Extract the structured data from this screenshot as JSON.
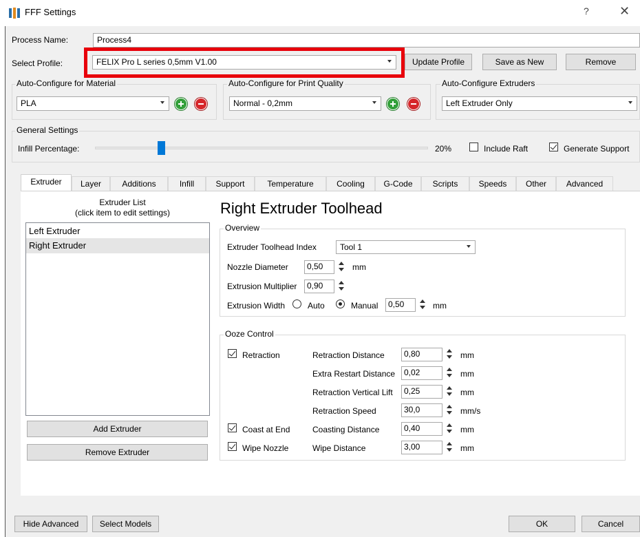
{
  "window": {
    "title": "FFF Settings",
    "help": "?",
    "close": "✕"
  },
  "process": {
    "label": "Process Name:",
    "value": "Process4"
  },
  "profile": {
    "label": "Select Profile:",
    "value": "FELIX Pro L series 0,5mm V1.00",
    "update": "Update Profile",
    "save_new": "Save as New",
    "remove": "Remove"
  },
  "auto_material": {
    "title": "Auto-Configure for Material",
    "value": "PLA"
  },
  "auto_quality": {
    "title": "Auto-Configure for Print Quality",
    "value": "Normal - 0,2mm"
  },
  "auto_extruders": {
    "title": "Auto-Configure Extruders",
    "value": "Left Extruder Only"
  },
  "general": {
    "title": "General Settings",
    "infill_label": "Infill Percentage:",
    "infill_value": "20%",
    "infill_fraction": 0.2,
    "raft_label": "Include Raft",
    "raft_checked": false,
    "support_label": "Generate Support",
    "support_checked": true
  },
  "tabs": [
    "Extruder",
    "Layer",
    "Additions",
    "Infill",
    "Support",
    "Temperature",
    "Cooling",
    "G-Code",
    "Scripts",
    "Speeds",
    "Other",
    "Advanced"
  ],
  "active_tab": "Extruder",
  "extruder_list": {
    "title_line1": "Extruder List",
    "title_line2": "(click item to edit settings)",
    "items": [
      "Left Extruder",
      "Right Extruder"
    ],
    "selected": "Right Extruder",
    "add": "Add Extruder",
    "remove": "Remove Extruder"
  },
  "toolhead": {
    "heading": "Right Extruder Toolhead",
    "overview_title": "Overview",
    "index_label": "Extruder Toolhead Index",
    "index_value": "Tool 1",
    "nozzle_label": "Nozzle Diameter",
    "nozzle_value": "0,50",
    "mult_label": "Extrusion Multiplier",
    "mult_value": "0,90",
    "width_label": "Extrusion Width",
    "auto_label": "Auto",
    "manual_label": "Manual",
    "width_value": "0,50",
    "unit_mm": "mm"
  },
  "ooze": {
    "title": "Ooze Control",
    "retraction_label": "Retraction",
    "coast_label": "Coast at End",
    "wipe_label": "Wipe Nozzle",
    "rows": [
      {
        "label": "Retraction Distance",
        "value": "0,80",
        "unit": "mm"
      },
      {
        "label": "Extra Restart Distance",
        "value": "0,02",
        "unit": "mm"
      },
      {
        "label": "Retraction Vertical Lift",
        "value": "0,25",
        "unit": "mm"
      },
      {
        "label": "Retraction Speed",
        "value": "30,0",
        "unit": "mm/s"
      },
      {
        "label": "Coasting Distance",
        "value": "0,40",
        "unit": "mm"
      },
      {
        "label": "Wipe Distance",
        "value": "3,00",
        "unit": "mm"
      }
    ]
  },
  "footer": {
    "hide_advanced": "Hide Advanced",
    "select_models": "Select Models",
    "ok": "OK",
    "cancel": "Cancel"
  },
  "colors": {
    "highlight": "#e8000b",
    "slider": "#0078d7",
    "plus": "#33a03a",
    "minus": "#d6262a"
  }
}
